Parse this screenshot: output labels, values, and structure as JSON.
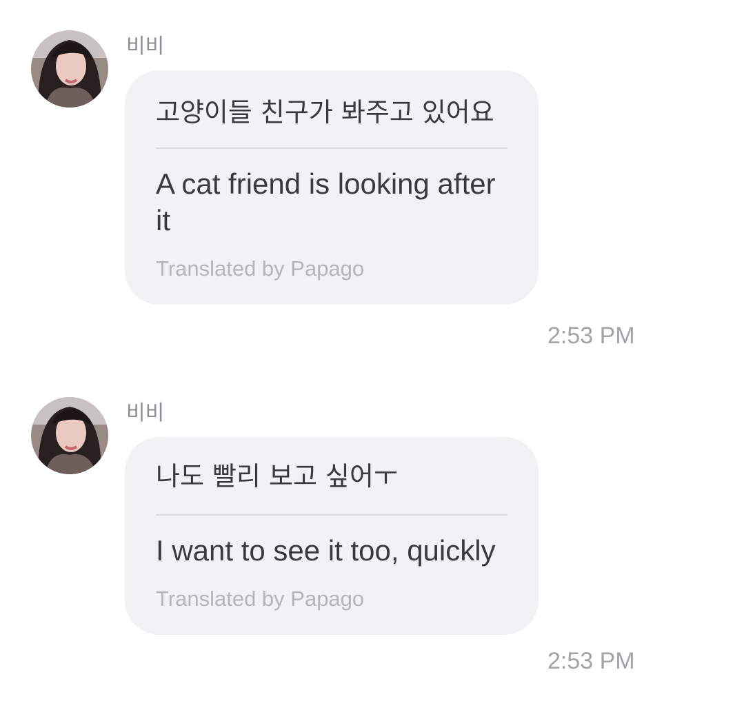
{
  "messages": [
    {
      "sender": "비비",
      "original": "고양이들 친구가 봐주고 있어요",
      "translated": "A cat friend is looking after it",
      "credit": "Translated by Papago",
      "time": "2:53 PM"
    },
    {
      "sender": "비비",
      "original": "나도 빨리 보고 싶어ㅜ",
      "translated": "I want to see it too, quickly",
      "credit": "Translated by Papago",
      "time": "2:53 PM"
    }
  ]
}
